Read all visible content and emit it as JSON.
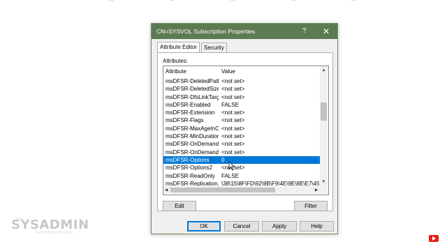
{
  "dialog": {
    "title": "CN=SYSVOL Subscription Properties",
    "help_glyph": "?",
    "close_glyph": "✕"
  },
  "tabs": [
    {
      "label": "Attribute Editor",
      "active": true
    },
    {
      "label": "Security",
      "active": false
    }
  ],
  "attributes_label": "Attributes:",
  "table": {
    "columns": [
      "Attribute",
      "Value"
    ],
    "rows": [
      {
        "attribute": "msDFSR-DeletedPath",
        "value": "<not set>"
      },
      {
        "attribute": "msDFSR-DeletedSize...",
        "value": "<not set>"
      },
      {
        "attribute": "msDFSR-DfsLinkTarget",
        "value": "<not set>"
      },
      {
        "attribute": "msDFSR-Enabled",
        "value": "FALSE"
      },
      {
        "attribute": "msDFSR-Extension",
        "value": "<not set>"
      },
      {
        "attribute": "msDFSR-Flags",
        "value": "<not set>"
      },
      {
        "attribute": "msDFSR-MaxAgeInC...",
        "value": "<not set>"
      },
      {
        "attribute": "msDFSR-MinDuration...",
        "value": "<not set>"
      },
      {
        "attribute": "msDFSR-OnDemand...",
        "value": "<not set>"
      },
      {
        "attribute": "msDFSR-OnDemand...",
        "value": "<not set>"
      },
      {
        "attribute": "msDFSR-Options",
        "value": "0",
        "selected": true
      },
      {
        "attribute": "msDFSR-Options2",
        "value": "<not set>"
      },
      {
        "attribute": "msDFSR-ReadOnly",
        "value": "FALSE"
      },
      {
        "attribute": "msDFSR-Replication...",
        "value": "\\38\\15\\8F\\FD\\92\\9B\\F9\\4E\\9E\\8E\\E7\\45"
      }
    ]
  },
  "buttons": {
    "edit": "Edit",
    "filter": "Filter",
    "ok": "OK",
    "cancel": "Cancel",
    "apply": "Apply",
    "help": "Help"
  },
  "watermark": {
    "brand": "SYSADMIN",
    "prefix": "THE",
    "tagline": "TECHNOLOGICAL"
  },
  "colors": {
    "titlebar": "#5d7b52",
    "selection": "#0078d7",
    "youtube": "#e62117"
  },
  "icons": [
    "help-icon",
    "close-icon",
    "scroll-up-arrow-icon",
    "scroll-down-arrow-icon",
    "scroll-left-arrow-icon",
    "scroll-right-arrow-icon",
    "youtube-subscribe-icon",
    "mouse-cursor-icon"
  ]
}
